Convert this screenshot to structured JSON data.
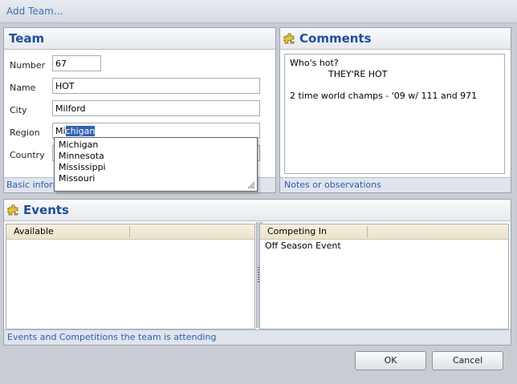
{
  "window": {
    "title": "Add Team..."
  },
  "team": {
    "title": "Team",
    "fields": {
      "number": {
        "label": "Number",
        "value": "67"
      },
      "name": {
        "label": "Name",
        "value": "HOT"
      },
      "city": {
        "label": "City",
        "value": "Milford"
      },
      "region": {
        "label": "Region",
        "typed": "Mi",
        "autocomplete": "chigan"
      },
      "country": {
        "label": "Country"
      }
    },
    "region_suggestions": [
      "Michigan",
      "Minnesota",
      "Mississippi",
      "Missouri"
    ],
    "footer": "Basic inform"
  },
  "comments": {
    "title": "Comments",
    "lines": [
      "Who's hot?",
      "THEY'RE HOT",
      "2 time world champs - '09 w/ 111 and 971"
    ],
    "footer": "Notes or observations"
  },
  "events": {
    "title": "Events",
    "available_header": "Available",
    "competing_header": "Competing In",
    "competing_items": [
      "Off Season Event"
    ],
    "footer": "Events and Competitions the team is attending"
  },
  "buttons": {
    "ok": "OK",
    "cancel": "Cancel"
  },
  "icons": {
    "comments": "puzzle-icon",
    "events": "puzzle-icon"
  },
  "colors": {
    "accent": "#1f4e9a",
    "selection": "#3160b8"
  }
}
